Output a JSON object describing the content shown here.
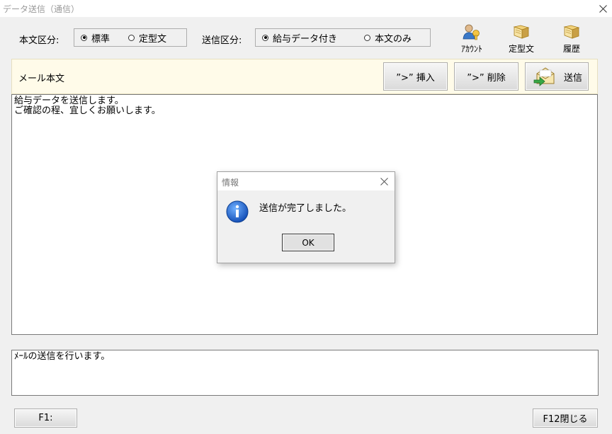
{
  "window": {
    "title": "データ送信（通信）"
  },
  "body_type": {
    "label": "本文区分:",
    "options": [
      {
        "label": "標準",
        "selected": true
      },
      {
        "label": "定型文",
        "selected": false
      }
    ]
  },
  "send_type": {
    "label": "送信区分:",
    "options": [
      {
        "label": "給与データ付き",
        "selected": true
      },
      {
        "label": "本文のみ",
        "selected": false
      }
    ]
  },
  "toolbar": {
    "account": "ｱｶｳﾝﾄ",
    "template": "定型文",
    "history": "履歴"
  },
  "mail": {
    "label": "メール本文",
    "insert_button": "”>” 挿入",
    "delete_button": "”>” 削除",
    "send_button": "送信",
    "body": "給与データを送信します。\nご確認の程、宜しくお願いします。"
  },
  "status": {
    "text": "ﾒｰﾙの送信を行います。"
  },
  "footer": {
    "f1": "F1:",
    "f12": "F12閉じる"
  },
  "dialog": {
    "title": "情報",
    "message": "送信が完了しました。",
    "ok": "OK"
  },
  "colors": {
    "mailbar_bg": "#fffbe9",
    "info_blue": "#1f6fd1"
  }
}
